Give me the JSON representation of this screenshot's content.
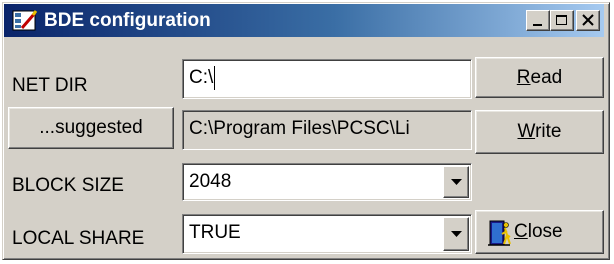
{
  "window": {
    "title": "BDE configuration",
    "icon": "bde-app-icon",
    "controls": [
      "minimize-icon",
      "maximize-icon",
      "close-icon"
    ]
  },
  "form": {
    "net_dir": {
      "label": "NET DIR",
      "value": "C:\\"
    },
    "suggested": {
      "button_label": "...suggested",
      "value": "C:\\Program Files\\PCSC\\Li"
    },
    "block_size": {
      "label": "BLOCK SIZE",
      "value": "2048"
    },
    "local_share": {
      "label": "LOCAL SHARE",
      "value": "TRUE"
    }
  },
  "buttons": {
    "read": {
      "mnemonic": "R",
      "rest": "ead"
    },
    "write": {
      "mnemonic": "W",
      "rest": "rite"
    },
    "close": {
      "mnemonic": "C",
      "rest": "lose",
      "icon": "door-exit-icon"
    }
  }
}
